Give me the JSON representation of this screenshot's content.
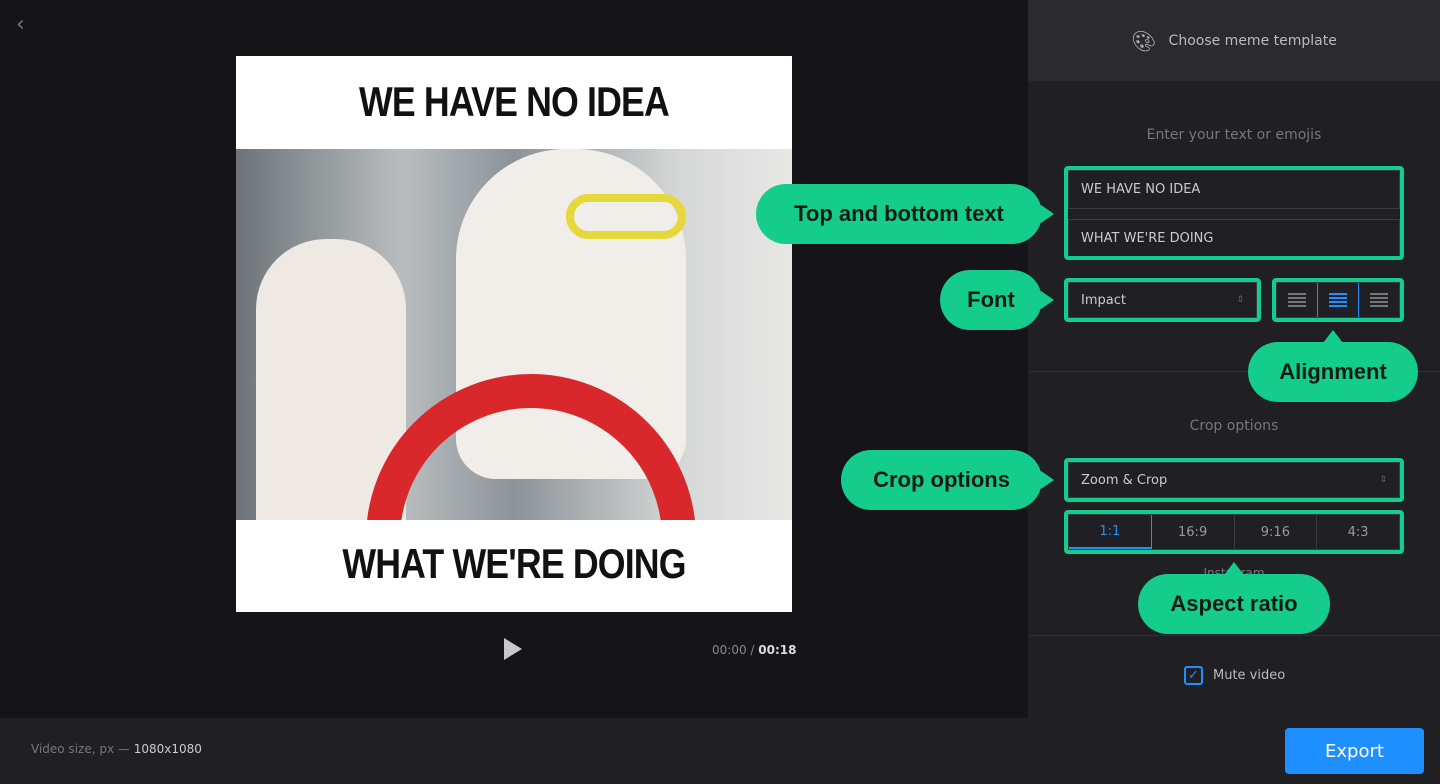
{
  "meme": {
    "top_text": "WE HAVE NO IDEA",
    "bottom_text": "WHAT WE'RE DOING"
  },
  "player": {
    "current": "00:00",
    "separator": "/",
    "duration": "00:18"
  },
  "panel": {
    "template_button": "Choose meme template",
    "text_section": "Enter your text or emojis",
    "top_field": "WE HAVE NO IDEA",
    "bottom_field": "WHAT WE'RE DOING",
    "font_select": "Impact",
    "alignment": [
      "left",
      "center",
      "right"
    ],
    "alignment_selected": "center",
    "crop_section": "Crop options",
    "crop_select": "Zoom & Crop",
    "ratios": [
      "1:1",
      "16:9",
      "9:16",
      "4:3"
    ],
    "ratio_selected": "1:1",
    "ratio_hint": "Instagram",
    "mute_label": "Mute video",
    "mute_checked": true
  },
  "footer": {
    "size_label": "Video size, px —",
    "size_value": "1080x1080",
    "export": "Export"
  },
  "callouts": {
    "text": "Top and bottom text",
    "font": "Font",
    "alignment": "Alignment",
    "crop": "Crop options",
    "ratio": "Aspect ratio"
  },
  "colors": {
    "accent": "#1e8fff",
    "callout": "#14cc8c"
  }
}
